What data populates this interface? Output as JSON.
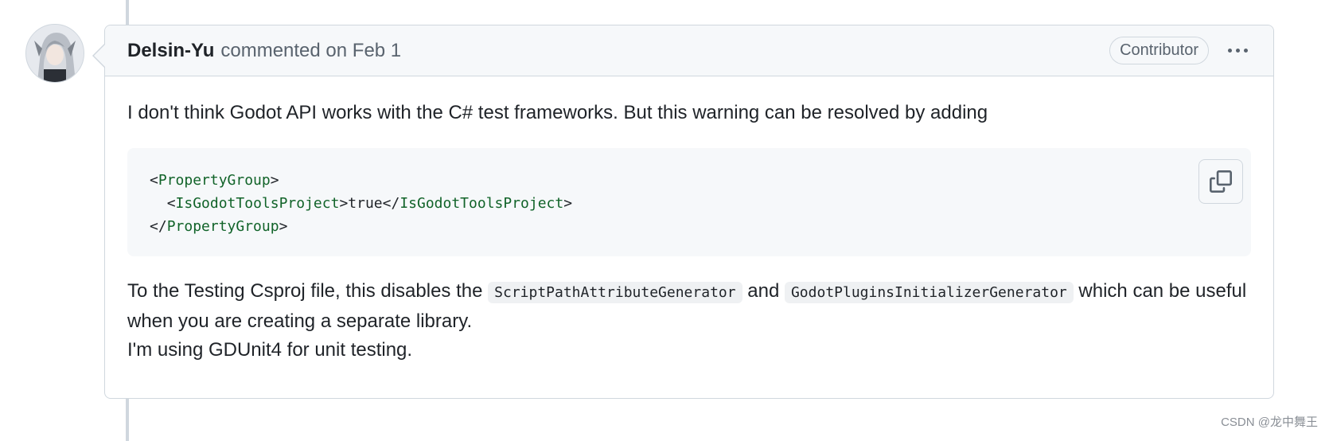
{
  "comment": {
    "author": "Delsin-Yu",
    "action_text": "commented on Feb 1",
    "badge": "Contributor",
    "menu_icon": "kebab-horizontal-icon",
    "body": {
      "para1": "I don't think Godot API works with the C# test frameworks. But this warning can be resolved by adding",
      "code": {
        "line1_open": "<",
        "line1_tag": "PropertyGroup",
        "line1_close": ">",
        "line2_indent": "  ",
        "line2_open": "<",
        "line2_tag": "IsGodotToolsProject",
        "line2_mid_close": ">",
        "line2_value": "true",
        "line2_end_open": "</",
        "line2_end_tag": "IsGodotToolsProject",
        "line2_end_close": ">",
        "line3_open": "</",
        "line3_tag": "PropertyGroup",
        "line3_close": ">",
        "copy_icon": "copy-icon"
      },
      "para2_part1": "To the Testing Csproj file, this disables the ",
      "inline_code1": "ScriptPathAttributeGenerator",
      "para2_part2": " and ",
      "inline_code2": "GodotPluginsInitializerGenerator",
      "para2_part3": " which can be useful when you are creating a separate library.",
      "para3": "I'm using GDUnit4 for unit testing."
    }
  },
  "watermark": "CSDN @龙中舞王",
  "colors": {
    "border": "#d0d7de",
    "header_bg": "#f6f8fa",
    "code_tag": "#116329",
    "muted_text": "#59636e"
  }
}
